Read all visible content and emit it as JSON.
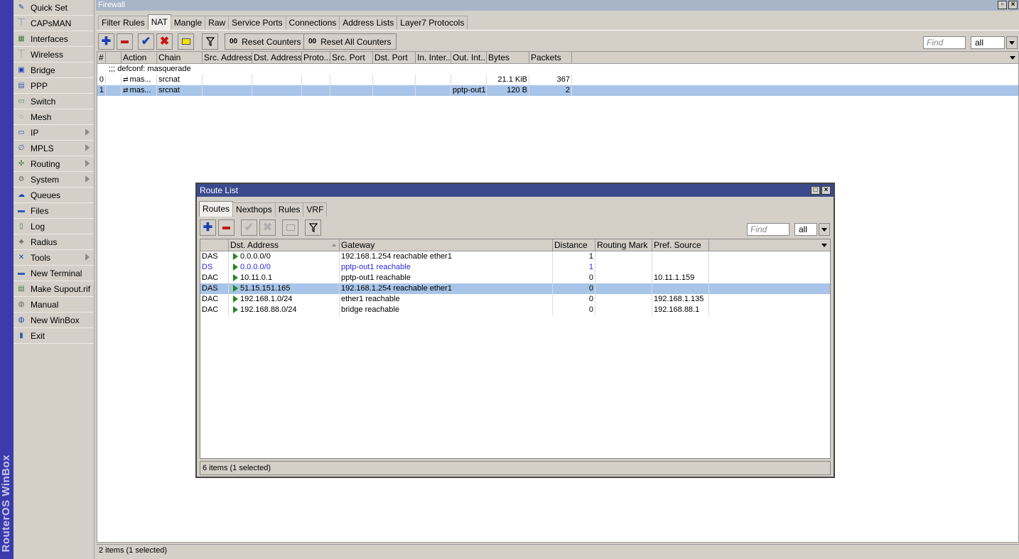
{
  "brand": "RouterOS WinBox",
  "menu": [
    {
      "label": "Quick Set",
      "icon": "quick-set-icon",
      "glyph": "✎"
    },
    {
      "label": "CAPsMAN",
      "icon": "capsman-icon",
      "glyph": "⏉"
    },
    {
      "label": "Interfaces",
      "icon": "interfaces-icon",
      "glyph": "▦"
    },
    {
      "label": "Wireless",
      "icon": "wireless-icon",
      "glyph": "⏉"
    },
    {
      "label": "Bridge",
      "icon": "bridge-icon",
      "glyph": "▣"
    },
    {
      "label": "PPP",
      "icon": "ppp-icon",
      "glyph": "▤"
    },
    {
      "label": "Switch",
      "icon": "switch-icon",
      "glyph": "▭"
    },
    {
      "label": "Mesh",
      "icon": "mesh-icon",
      "glyph": "◌"
    },
    {
      "label": "IP",
      "icon": "ip-icon",
      "glyph": "▭",
      "submenu": true
    },
    {
      "label": "MPLS",
      "icon": "mpls-icon",
      "glyph": "∅",
      "submenu": true
    },
    {
      "label": "Routing",
      "icon": "routing-icon",
      "glyph": "✣",
      "submenu": true
    },
    {
      "label": "System",
      "icon": "system-icon",
      "glyph": "⚙",
      "submenu": true
    },
    {
      "label": "Queues",
      "icon": "queues-icon",
      "glyph": "☁"
    },
    {
      "label": "Files",
      "icon": "files-icon",
      "glyph": "▬"
    },
    {
      "label": "Log",
      "icon": "log-icon",
      "glyph": "▯"
    },
    {
      "label": "Radius",
      "icon": "radius-icon",
      "glyph": "♣"
    },
    {
      "label": "Tools",
      "icon": "tools-icon",
      "glyph": "✕",
      "submenu": true
    },
    {
      "label": "New Terminal",
      "icon": "terminal-icon",
      "glyph": "▬"
    },
    {
      "label": "Make Supout.rif",
      "icon": "supout-icon",
      "glyph": "▤"
    },
    {
      "label": "Manual",
      "icon": "manual-icon",
      "glyph": "◍"
    },
    {
      "label": "New WinBox",
      "icon": "winbox-icon",
      "glyph": "◍"
    },
    {
      "label": "Exit",
      "icon": "exit-icon",
      "glyph": "▮"
    }
  ],
  "firewall": {
    "title": "Firewall",
    "tabs": [
      "Filter Rules",
      "NAT",
      "Mangle",
      "Raw",
      "Service Ports",
      "Connections",
      "Address Lists",
      "Layer7 Protocols"
    ],
    "active_tab": "NAT",
    "toolbar": {
      "reset_counters": "Reset Counters",
      "reset_all_counters": "Reset All Counters",
      "counter_glyph": "00",
      "find_placeholder": "Find",
      "filter_value": "all"
    },
    "columns": [
      "#",
      "",
      "Action",
      "Chain",
      "Src. Address",
      "Dst. Address",
      "Proto...",
      "Src. Port",
      "Dst. Port",
      "In. Inter...",
      "Out. Int...",
      "Bytes",
      "Packets"
    ],
    "comment": ";;; defconf: masquerade",
    "rows": [
      {
        "num": "0",
        "action": "mas...",
        "chain": "srcnat",
        "out_int": "",
        "bytes": "21.1 KiB",
        "packets": "367",
        "selected": false
      },
      {
        "num": "1",
        "action": "mas...",
        "chain": "srcnat",
        "out_int": "pptp-out1",
        "bytes": "120 B",
        "packets": "2",
        "selected": true
      }
    ],
    "status": "2 items (1 selected)"
  },
  "route_list": {
    "title": "Route List",
    "tabs": [
      "Routes",
      "Nexthops",
      "Rules",
      "VRF"
    ],
    "active_tab": "Routes",
    "find_placeholder": "Find",
    "filter_value": "all",
    "columns": [
      "",
      "Dst. Address",
      "Gateway",
      "Distance",
      "Routing Mark",
      "Pref. Source"
    ],
    "rows": [
      {
        "flags": "DAS",
        "dst": "0.0.0.0/0",
        "gateway": "192.168.1.254 reachable ether1",
        "distance": "1",
        "mark": "",
        "pref": "",
        "selected": false,
        "blue": false
      },
      {
        "flags": "DS",
        "dst": "0.0.0.0/0",
        "gateway": "pptp-out1 reachable",
        "distance": "1",
        "mark": "",
        "pref": "",
        "selected": false,
        "blue": true
      },
      {
        "flags": "DAC",
        "dst": "10.11.0.1",
        "gateway": "pptp-out1 reachable",
        "distance": "0",
        "mark": "",
        "pref": "10.11.1.159",
        "selected": false,
        "blue": false
      },
      {
        "flags": "DAS",
        "dst": "51.15.151.165",
        "gateway": "192.168.1.254 reachable ether1",
        "distance": "0",
        "mark": "",
        "pref": "",
        "selected": true,
        "blue": false
      },
      {
        "flags": "DAC",
        "dst": "192.168.1.0/24",
        "gateway": "ether1 reachable",
        "distance": "0",
        "mark": "",
        "pref": "192.168.1.135",
        "selected": false,
        "blue": false
      },
      {
        "flags": "DAC",
        "dst": "192.168.88.0/24",
        "gateway": "bridge reachable",
        "distance": "0",
        "mark": "",
        "pref": "192.168.88.1",
        "selected": false,
        "blue": false
      }
    ],
    "status": "6 items (1 selected)"
  }
}
